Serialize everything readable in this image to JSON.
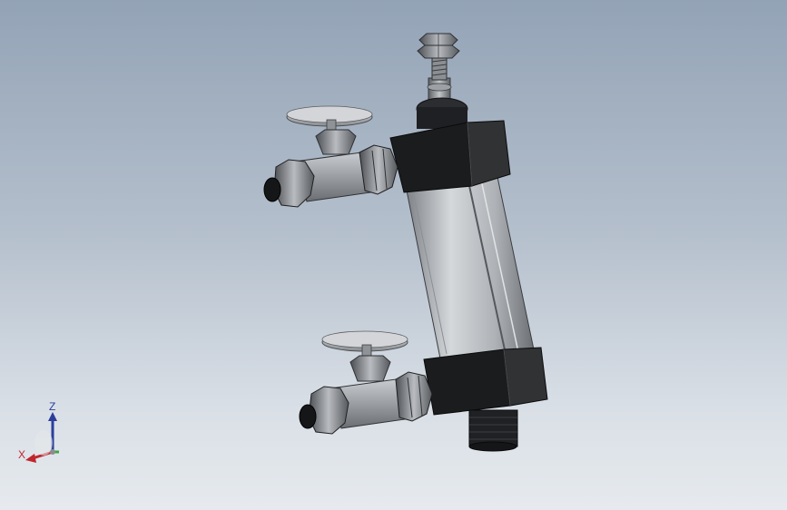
{
  "viewport": {
    "background_top": "#93a3b6",
    "background_bottom": "#e6eaee"
  },
  "model": {
    "colors": {
      "anodized_black": "#1b1c1e",
      "anodized_black_side": "#303234",
      "aluminum_light": "#c5c9cd",
      "aluminum_dark": "#7d8186",
      "steel": "#a8acb0",
      "steel_dark": "#5b5e62"
    },
    "parts": [
      "pneumatic-cylinder",
      "piston-rod",
      "rod-lock-nut",
      "front-end-cap",
      "rear-end-cap",
      "rear-port-fitting",
      "flow-control-valve-top",
      "flow-control-valve-bottom"
    ]
  },
  "triad": {
    "z_label": "Z",
    "x_label": "X",
    "z_color": "#2b3f9a",
    "x_color": "#c0262c",
    "y_color": "#3aa845"
  }
}
